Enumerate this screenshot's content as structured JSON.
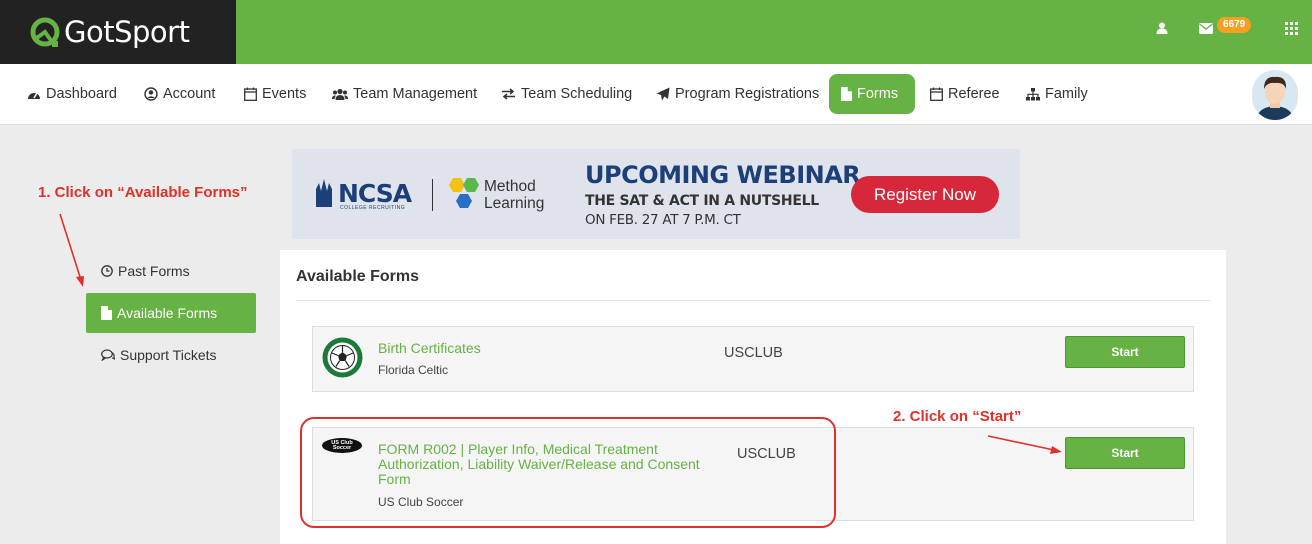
{
  "header": {
    "logo_text": "GotSport",
    "notification_count": "6679",
    "icons": [
      "user-icon",
      "envelope-icon",
      "grid-icon"
    ]
  },
  "nav": {
    "items": [
      {
        "label": "Dashboard",
        "icon": "dashboard-icon"
      },
      {
        "label": "Account",
        "icon": "user-circle-icon"
      },
      {
        "label": "Events",
        "icon": "calendar-icon"
      },
      {
        "label": "Team Management",
        "icon": "users-icon"
      },
      {
        "label": "Team Scheduling",
        "icon": "exchange-icon"
      },
      {
        "label": "Program Registrations",
        "icon": "paper-plane-icon"
      },
      {
        "label": "Forms",
        "icon": "file-icon",
        "active": true
      },
      {
        "label": "Referee",
        "icon": "calendar-icon"
      },
      {
        "label": "Family",
        "icon": "sitemap-icon"
      }
    ]
  },
  "banner": {
    "brand": "NCSA",
    "brand_sub": "COLLEGE RECRUITING",
    "partner": "Method Learning",
    "partner_line1": "Method",
    "partner_line2": "Learning",
    "title": "UPCOMING WEBINAR",
    "subtitle": "THE SAT & ACT IN A NUTSHELL",
    "date_line": "ON FEB. 27 AT 7 P.M. CT",
    "cta": "Register Now"
  },
  "sidebar": {
    "items": [
      {
        "label": "Past Forms",
        "icon": "clock-icon"
      },
      {
        "label": "Available Forms",
        "icon": "file-icon",
        "active": true
      },
      {
        "label": "Support Tickets",
        "icon": "comments-icon"
      }
    ]
  },
  "main": {
    "title": "Available Forms",
    "forms": [
      {
        "name": "Birth Certificates",
        "org": "Florida Celtic",
        "type": "USCLUB",
        "action": "Start",
        "logo": "soccer-ball-crest"
      },
      {
        "name_lines": [
          "FORM R002 | Player Info, Medical Treatment",
          "Authorization, Liability Waiver/Release and Consent",
          "Form"
        ],
        "org": "US Club Soccer",
        "type": "USCLUB",
        "action": "Start",
        "logo": "us-club-soccer-logo",
        "logo_text": "US Club Soccer"
      }
    ]
  },
  "annotations": {
    "step1": "1. Click on “Available Forms”",
    "step2": "2. Click on “Start”",
    "color": "#e0302a"
  },
  "colors": {
    "brand_green": "#66b244",
    "header_dark": "#222222",
    "badge_orange": "#f4a022",
    "cta_red": "#d7283b",
    "ncsa_blue": "#1c3f7a"
  }
}
